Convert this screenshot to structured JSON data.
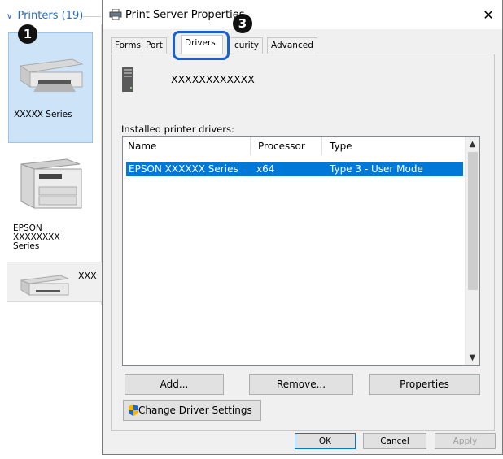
{
  "printers_panel": {
    "header": "Printers (19)",
    "items": [
      {
        "label": "XXXXX Series"
      },
      {
        "label_lines": [
          "EPSON",
          "XXXXXXXX",
          "Series"
        ]
      }
    ],
    "floating_item_label": "XXX"
  },
  "steps": {
    "step1": "1",
    "step3": "3"
  },
  "dialog": {
    "title": "Print Server Properties",
    "tabs": [
      {
        "label": "Forms"
      },
      {
        "label": "Port"
      },
      {
        "label": "Drivers",
        "active": true
      },
      {
        "label": "curity"
      },
      {
        "label": "Advanced"
      }
    ],
    "server_name": "XXXXXXXXXXXX",
    "installed_label": "Installed printer drivers:",
    "columns": [
      "Name",
      "Processor",
      "Type"
    ],
    "rows": [
      {
        "name": "EPSON XXXXXX Series",
        "processor": "x64",
        "type": "Type 3 - User Mode",
        "selected": true
      }
    ],
    "buttons": {
      "add": "Add...",
      "remove": "Remove...",
      "properties": "Properties",
      "change_driver_settings": "Change Driver Settings",
      "ok": "OK",
      "cancel": "Cancel",
      "apply": "Apply"
    }
  },
  "colors": {
    "selection": "#0078d7",
    "highlight_ring": "#1a5fd0",
    "header_link": "#2b6cb8"
  }
}
